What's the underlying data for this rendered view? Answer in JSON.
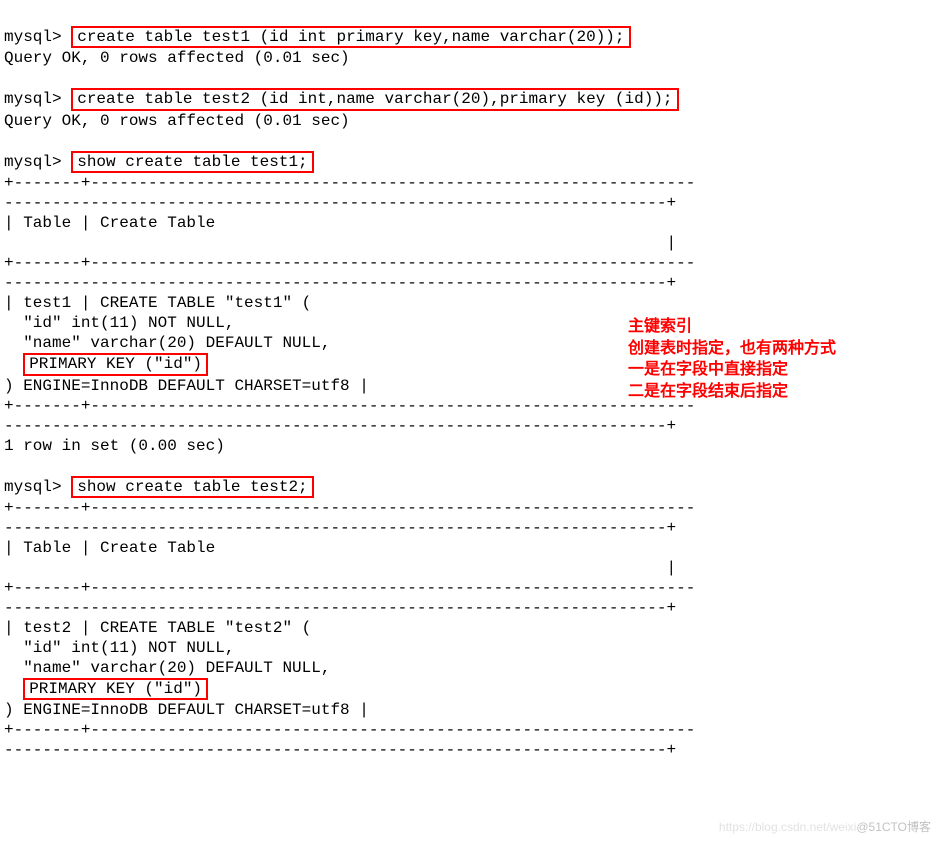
{
  "lines": {
    "prompt": "mysql>",
    "cmd1": "create table test1 (id int primary key,name varchar(20));",
    "resp1": "Query OK, 0 rows affected (0.01 sec)",
    "cmd2": "create table test2 (id int,name varchar(20),primary key (id));",
    "resp2": "Query OK, 0 rows affected (0.01 sec)",
    "cmd3": "show create table test1;",
    "sep_short": "+-------+---------------------------------------------------------------",
    "sep_tail": "---------------------------------------------------------------------+",
    "header_row1": "| Table | Create Table ",
    "header_row2": "                                                                     |",
    "t1_l1": "| test1 | CREATE TABLE \"test1\" (",
    "t_l2": "  \"id\" int(11) NOT NULL,",
    "t_l3": "  \"name\" varchar(20) DEFAULT NULL,",
    "pk": "PRIMARY KEY (\"id\")",
    "t_l5": ") ENGINE=InnoDB DEFAULT CHARSET=utf8 |",
    "rows_in_set": "1 row in set (0.00 sec)",
    "cmd4": "show create table test2;",
    "t2_l1": "| test2 | CREATE TABLE \"test2\" ("
  },
  "annotation": {
    "l1": "主键索引",
    "l2": "创建表时指定，也有两种方式",
    "l3": "一是在字段中直接指定",
    "l4": "二是在字段结束后指定"
  },
  "watermark": {
    "faint": "https://blog.csdn.net/weixi",
    "text": "@51CTO博客"
  }
}
